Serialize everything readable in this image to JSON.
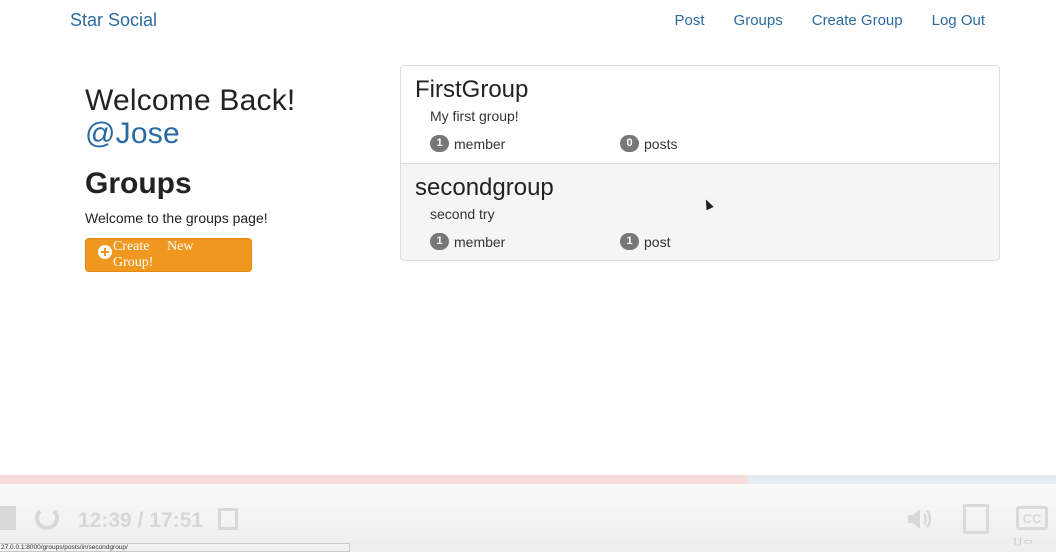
{
  "navbar": {
    "brand": "Star Social",
    "links": [
      "Post",
      "Groups",
      "Create Group",
      "Log Out"
    ]
  },
  "sidebar": {
    "welcome": "Welcome Back!",
    "username": "@Jose",
    "heading": "Groups",
    "subtitle": "Welcome to the groups page!",
    "create_button": "Create New Group!"
  },
  "groups": [
    {
      "name": "FirstGroup",
      "description": "My first group!",
      "members_count": "1",
      "members_label": "member",
      "posts_count": "0",
      "posts_label": "posts"
    },
    {
      "name": "secondgroup",
      "description": "second try",
      "members_count": "1",
      "members_label": "member",
      "posts_count": "1",
      "posts_label": "post"
    }
  ],
  "player": {
    "time": "12:39 / 17:51",
    "progress_fraction": 0.708,
    "cc_label": "CC"
  },
  "status_bar": {
    "url": "27.0.0.1:8000/groups/posts/in/secondgroup/"
  },
  "colors": {
    "link": "#2c6aa0",
    "button": "#f0971f",
    "badge": "#777777"
  }
}
